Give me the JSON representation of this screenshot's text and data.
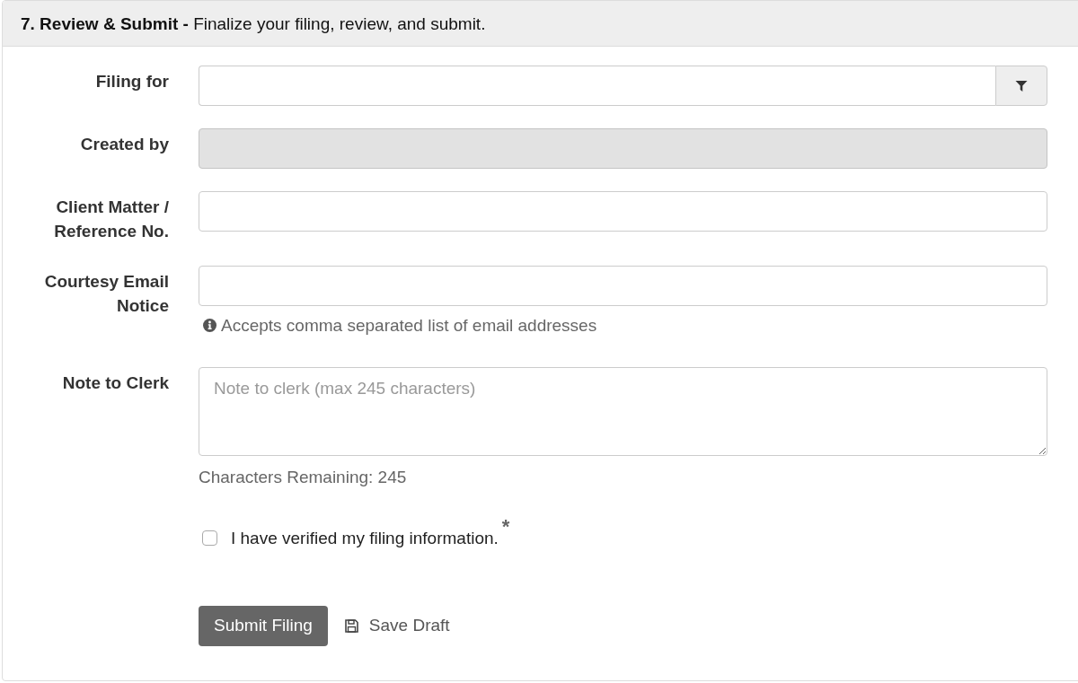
{
  "header": {
    "title": "**7. Review & Submit -** Finalize your filing, review, and submit."
  },
  "fields": [
    {
      "kind": "select",
      "label": "Filing for",
      "disabled": false
    },
    {
      "kind": "text",
      "label": "Created by",
      "disabled": true
    },
    {
      "kind": "text",
      "label": "Client Matter / Reference No.",
      "disabled": false
    },
    {
      "kind": "text",
      "label": "Courtesy Email Notice",
      "disabled": false,
      "help": "Accepts comma separated list of email addresses"
    },
    {
      "kind": "textarea",
      "label": "Note to Clerk",
      "disabled": false,
      "placeholder": "Note to clerk (max 245 characters)",
      "counter": "Characters Remaining: 245"
    }
  ],
  "verify": {
    "label": "I have verified my filing information.",
    "required_mark": "*",
    "checked": false
  },
  "actions": {
    "submit": "Submit Filing",
    "save_draft": "Save Draft"
  }
}
